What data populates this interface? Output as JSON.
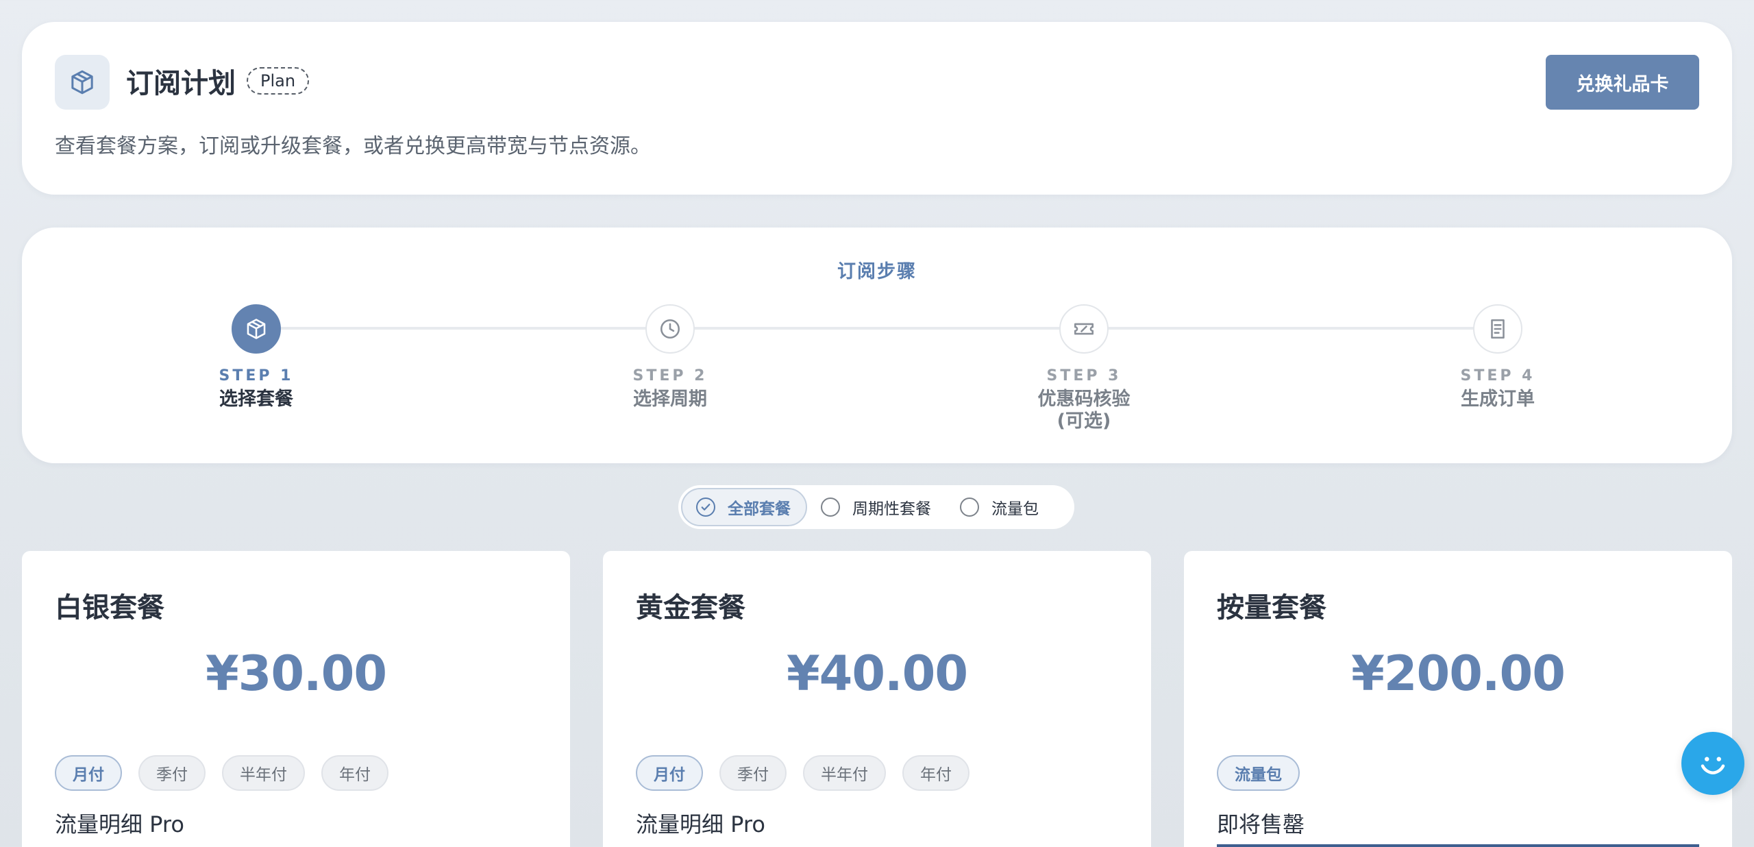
{
  "header": {
    "icon": "package-icon",
    "title": "订阅计划",
    "badge": "Plan",
    "description": "查看套餐方案，订阅或升级套餐，或者兑换更高带宽与节点资源。",
    "redeem_label": "兑换礼品卡"
  },
  "steps": {
    "title": "订阅步骤",
    "items": [
      {
        "num": "STEP 1",
        "label": "选择套餐",
        "icon": "package-icon",
        "active": true
      },
      {
        "num": "STEP 2",
        "label": "选择周期",
        "icon": "clock-icon",
        "active": false
      },
      {
        "num": "STEP 3",
        "label": "优惠码核验\n(可选)",
        "icon": "ticket-icon",
        "active": false
      },
      {
        "num": "STEP 4",
        "label": "生成订单",
        "icon": "receipt-icon",
        "active": false
      }
    ]
  },
  "filter": {
    "options": [
      {
        "label": "全部套餐",
        "selected": true
      },
      {
        "label": "周期性套餐",
        "selected": false
      },
      {
        "label": "流量包",
        "selected": false
      }
    ]
  },
  "plans": [
    {
      "name": "白银套餐",
      "price": "¥30.00",
      "periods": [
        {
          "label": "月付",
          "active": true
        },
        {
          "label": "季付",
          "active": false
        },
        {
          "label": "半年付",
          "active": false
        },
        {
          "label": "年付",
          "active": false
        }
      ],
      "detail": "流量明细 Pro"
    },
    {
      "name": "黄金套餐",
      "price": "¥40.00",
      "periods": [
        {
          "label": "月付",
          "active": true
        },
        {
          "label": "季付",
          "active": false
        },
        {
          "label": "半年付",
          "active": false
        },
        {
          "label": "年付",
          "active": false
        }
      ],
      "detail": "流量明细 Pro"
    },
    {
      "name": "按量套餐",
      "price": "¥200.00",
      "periods": [
        {
          "label": "流量包",
          "active": true
        }
      ],
      "detail": "即将售罄",
      "stock_progress": 1.0
    }
  ],
  "chat": {
    "icon": "chat-smile-icon"
  },
  "colors": {
    "accent": "#6383b1",
    "button": "#6685b0",
    "chat": "#2aa7e9"
  }
}
